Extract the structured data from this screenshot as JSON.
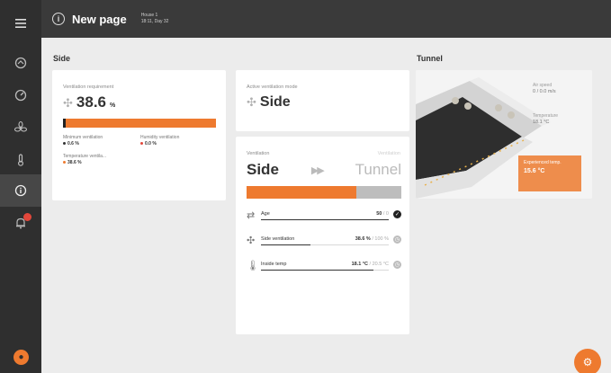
{
  "header": {
    "title": "New page",
    "house_name": "House 1",
    "house_time": "18:11, Day 32",
    "menu_icon": "menu-icon",
    "info_icon": "info-icon"
  },
  "sidebar": {
    "items": [
      {
        "icon": "home-icon"
      },
      {
        "icon": "gauge-icon"
      },
      {
        "icon": "fan-icon"
      },
      {
        "icon": "thermometer-icon"
      },
      {
        "icon": "info-circle-icon",
        "active": true
      },
      {
        "icon": "alarm-bell-icon",
        "badge": true
      }
    ]
  },
  "sections": {
    "side": "Side",
    "tunnel": "Tunnel"
  },
  "ventilation_requirement": {
    "label": "Ventilation requirement",
    "value": "38.6",
    "unit": "%",
    "level_percent": 2,
    "minimum_label": "Minimum ventilation",
    "minimum_value": "0.6 %",
    "humidity_label": "Humidity ventilation",
    "humidity_value": "0.0 %",
    "temperature_label": "Temperature ventila...",
    "temperature_value": "38.6 %"
  },
  "active_mode": {
    "label": "Active ventilation mode",
    "value": "Side"
  },
  "ventilation": {
    "label": "Ventilation",
    "label_right": "Ventilation",
    "from_mode": "Side",
    "to_mode": "Tunnel",
    "arrow": "▶▶",
    "progress_percent": 71,
    "rows": [
      {
        "name": "Age",
        "value": "50",
        "limit": " / 0",
        "fill_percent": 100,
        "status": "ok",
        "status_color": "#222222"
      },
      {
        "name": "Side ventilation",
        "value": "38.6 %",
        "limit": " / 100 %",
        "fill_percent": 39,
        "status": "pending",
        "status_color": "#bdbdbd"
      },
      {
        "name": "Inside temp",
        "value": "18.1 °C",
        "limit": " / 20.5 °C",
        "fill_percent": 88,
        "status": "pending",
        "status_color": "#bdbdbd"
      }
    ]
  },
  "tunnel": {
    "air_speed_label": "Air speed",
    "air_speed_value": "0 / 0.0 m/s",
    "temperature_label": "Temperature",
    "temperature_value": "18.1 °C",
    "experienced_label": "Experienced temp.",
    "experienced_value": "15.6 °C"
  },
  "colors": {
    "accent": "#ee7a2f",
    "sidebar": "#2f2f2f",
    "topbar": "#3a3a3a",
    "background": "#ececec",
    "alarm": "#e2473b"
  },
  "fab_icon": "settings-icon",
  "avatar_icon": "user-avatar-icon"
}
